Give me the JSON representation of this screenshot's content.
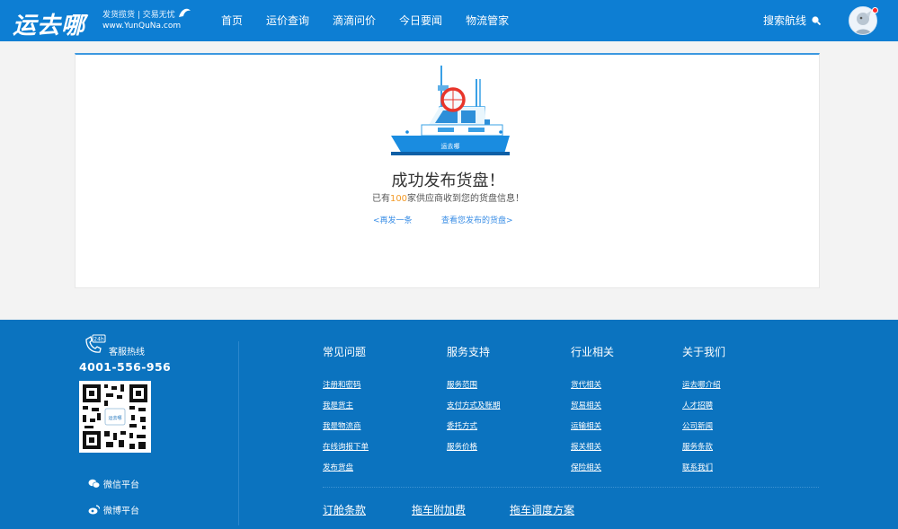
{
  "header": {
    "logo": "运去哪",
    "slogan_line1": "发货揽货 | 交易无忧",
    "slogan_line2": "www.YunQuNa.com",
    "nav": [
      "首页",
      "运价查询",
      "滴滴问价",
      "今日要闻",
      "物流管家"
    ],
    "search_label": "搜索航线"
  },
  "success": {
    "ship_label": "运去哪",
    "title": "成功发布货盘！",
    "sub_prefix": "已有",
    "sub_count": "100",
    "sub_suffix": "家供应商收到您的货盘信息！",
    "link_again": "<再发一条",
    "link_view": "查看您发布的货盘>"
  },
  "footer": {
    "hotline_badge": "24h",
    "hotline_label": "客服热线",
    "hotline_number": "4001-556-956",
    "qr_center": "运去哪",
    "wechat": "微信平台",
    "weibo": "微博平台",
    "columns": [
      {
        "title": "常见问题",
        "items": [
          "注册和密码",
          "我是货主",
          "我是物流商",
          "在线询报下单",
          "发布货盘"
        ]
      },
      {
        "title": "服务支持",
        "items": [
          "服务范围",
          "支付方式及账期",
          "委托方式",
          "服务价格"
        ]
      },
      {
        "title": "行业相关",
        "items": [
          "货代相关",
          "贸易相关",
          "运输相关",
          "报关相关",
          "保险相关"
        ]
      },
      {
        "title": "关于我们",
        "items": [
          "运去哪介绍",
          "人才招聘",
          "公司新闻",
          "服务条款",
          "联系我们"
        ]
      }
    ],
    "bottom_links": [
      "订舱条款",
      "拖车附加费",
      "拖车调度方案"
    ]
  },
  "colors": {
    "header_bg": "#0d7ed3",
    "footer_bg": "#0b73bf",
    "accent_link": "#3a8ee6",
    "highlight": "#f39a27"
  }
}
